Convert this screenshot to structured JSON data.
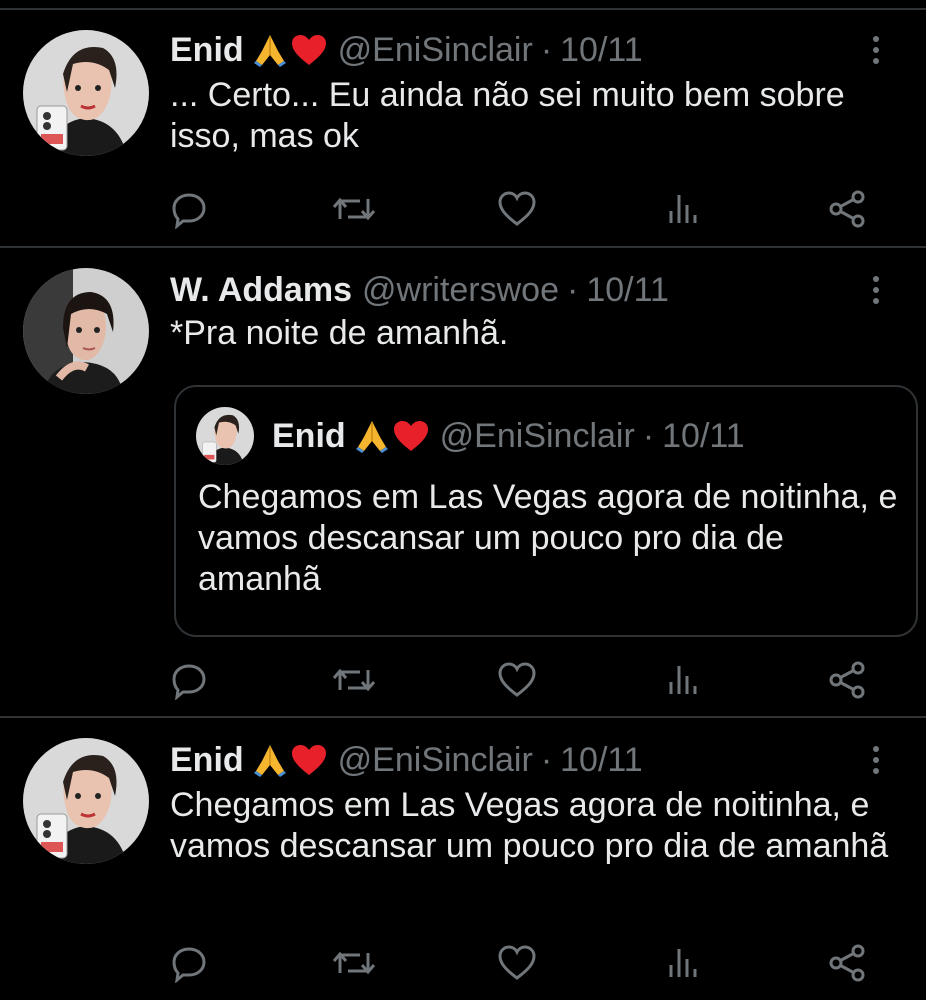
{
  "colors": {
    "background": "#000000",
    "text": "#e7e9ea",
    "muted": "#71767b",
    "border": "#2f3336"
  },
  "emoji": [
    "folded-hands",
    "red-heart"
  ],
  "tweets": [
    {
      "name": "Enid",
      "handle": "@EniSinclair",
      "separator": "·",
      "date": "10/11",
      "text": "... Certo... Eu ainda não sei muito bem sobre isso, mas ok"
    },
    {
      "name": "W. Addams",
      "handle": "@writerswoe",
      "separator": "·",
      "date": "10/11",
      "text": "*Pra noite de amanhã.",
      "quote": {
        "name": "Enid",
        "handle": "@EniSinclair",
        "separator": "·",
        "date": "10/11",
        "text": "Chegamos em Las Vegas agora de noitinha, e vamos descansar um pouco pro dia de amanhã"
      }
    },
    {
      "name": "Enid",
      "handle": "@EniSinclair",
      "separator": "·",
      "date": "10/11",
      "text": "Chegamos em Las Vegas agora de noitinha, e vamos descansar um pouco pro dia de amanhã"
    }
  ],
  "action_icons": [
    "reply-icon",
    "retweet-icon",
    "like-icon",
    "views-icon",
    "share-icon"
  ]
}
